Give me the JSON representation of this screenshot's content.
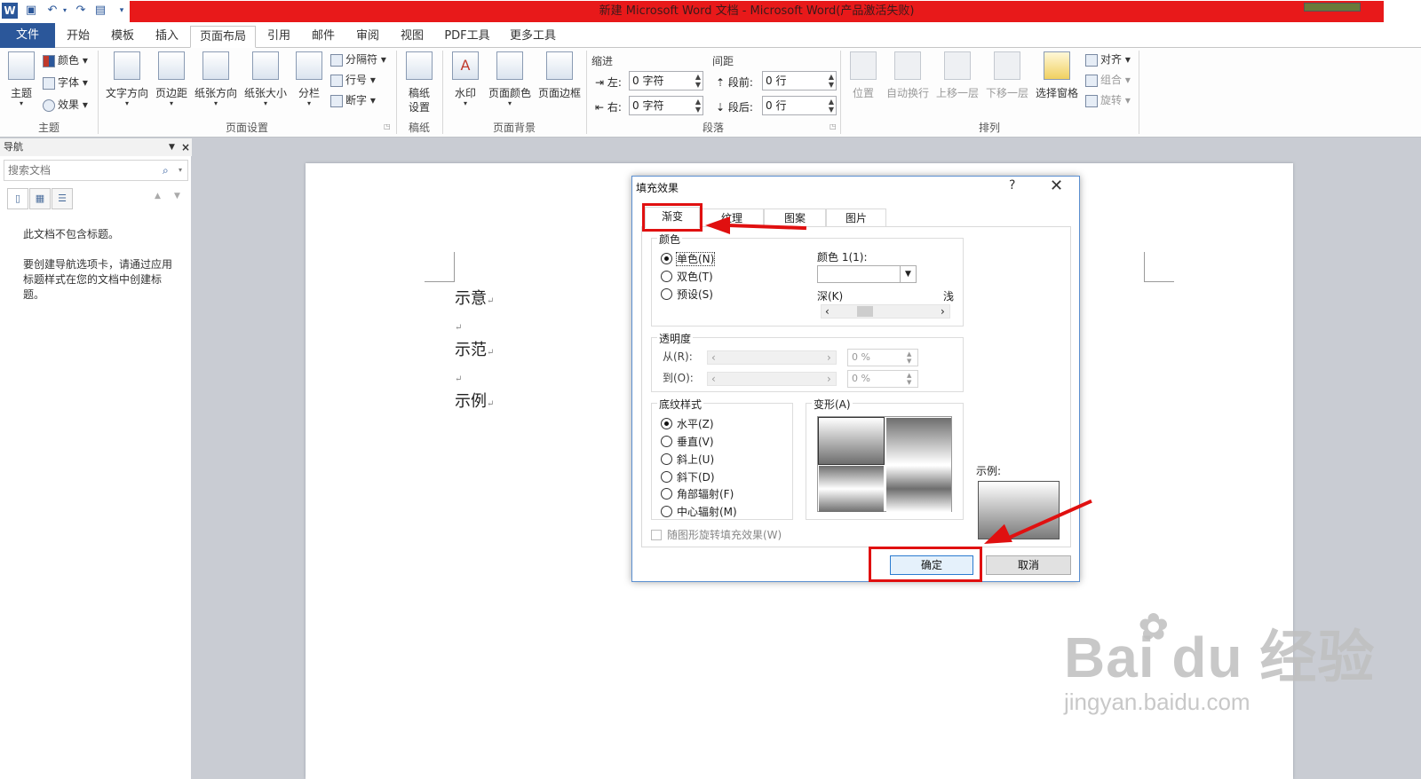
{
  "window": {
    "title": "新建 Microsoft Word 文档 - Microsoft Word(产品激活失败)",
    "app_icon": "W"
  },
  "tabs": [
    "文件",
    "开始",
    "模板",
    "插入",
    "页面布局",
    "引用",
    "邮件",
    "审阅",
    "视图",
    "PDF工具",
    "更多工具"
  ],
  "active_tab": "页面布局",
  "ribbon": {
    "theme_group": {
      "label": "主题",
      "themes": "主题",
      "colors": "颜色",
      "fonts": "字体",
      "effects": "效果"
    },
    "page_setup": {
      "label": "页面设置",
      "text_direction": "文字方向",
      "margins": "页边距",
      "orientation": "纸张方向",
      "size": "纸张大小",
      "columns": "分栏",
      "breaks": "分隔符",
      "line_numbers": "行号",
      "hyphenation": "断字"
    },
    "manuscript": {
      "label": "稿纸",
      "settings_line1": "稿纸",
      "settings_line2": "设置"
    },
    "page_background": {
      "label": "页面背景",
      "watermark": "水印",
      "page_color": "页面颜色",
      "page_borders": "页面边框"
    },
    "paragraph": {
      "label": "段落",
      "indent_title": "缩进",
      "spacing_title": "间距",
      "left_label": "左:",
      "left_value": "0 字符",
      "right_label": "右:",
      "right_value": "0 字符",
      "before_label": "段前:",
      "before_value": "0 行",
      "after_label": "段后:",
      "after_value": "0 行"
    },
    "arrange": {
      "label": "排列",
      "position": "位置",
      "wrap_text": "自动换行",
      "bring_forward": "上移一层",
      "send_backward": "下移一层",
      "selection_pane": "选择窗格",
      "align": "对齐",
      "group": "组合",
      "rotate": "旋转"
    }
  },
  "nav_pane": {
    "title": "导航",
    "search_placeholder": "搜索文档",
    "message1": "此文档不包含标题。",
    "message2": "要创建导航选项卡，请通过应用标题样式在您的文档中创建标题。"
  },
  "document": {
    "lines": [
      "示意",
      "示范",
      "示例"
    ]
  },
  "dialog": {
    "title": "填充效果",
    "help": "?",
    "close": "✕",
    "tabs": [
      "渐变",
      "纹理",
      "图案",
      "图片"
    ],
    "active_tab": "渐变",
    "colors_section": "颜色",
    "color_options": [
      "单色(N)",
      "双色(T)",
      "预设(S)"
    ],
    "selected_color_option": "单色(N)",
    "color1_label": "颜色 1(1):",
    "dark_label": "深(K)",
    "light_label": "浅",
    "transparency_section": "透明度",
    "from_label": "从(R):",
    "to_label": "到(O):",
    "from_value": "0 %",
    "to_value": "0 %",
    "shading_section": "底纹样式",
    "shading_options": [
      "水平(Z)",
      "垂直(V)",
      "斜上(U)",
      "斜下(D)",
      "角部辐射(F)",
      "中心辐射(M)"
    ],
    "selected_shading": "水平(Z)",
    "variants_section": "变形(A)",
    "sample_label": "示例:",
    "rotate_checkbox": "随图形旋转填充效果(W)",
    "ok": "确定",
    "cancel": "取消"
  },
  "watermark": {
    "logo": "Bai du 经验",
    "url": "jingyan.baidu.com"
  },
  "colors": {
    "word_blue": "#2b579a",
    "title_red": "#e8191a",
    "annotation_red": "#e01010"
  }
}
